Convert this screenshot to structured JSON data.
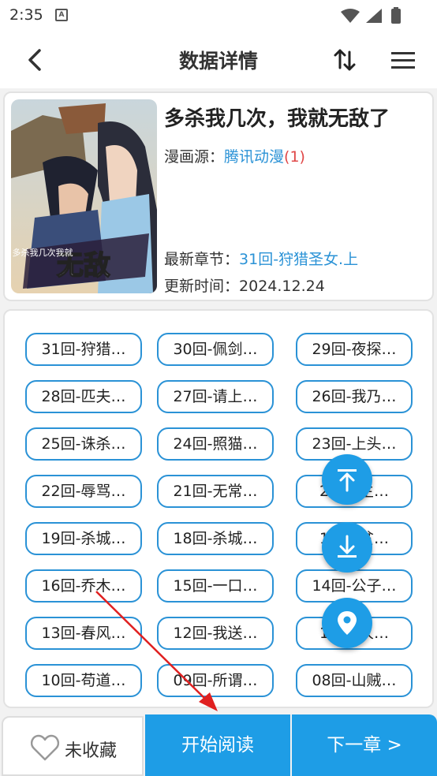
{
  "status": {
    "time": "2:35"
  },
  "appbar": {
    "title": "数据详情"
  },
  "comic": {
    "title": "多杀我几次，我就无敌了",
    "source_label": "漫画源：",
    "source_name": "腾讯动漫",
    "source_count": "(1)",
    "latest_label": "最新章节：",
    "latest_value": "31回-狩猎圣女.上",
    "update_label": "更新时间：",
    "update_value": "2024.12.24",
    "cover_title": "无敌",
    "cover_subtitle": "多杀我几次我就"
  },
  "chapters": [
    "31回-狩猎…",
    "30回-佩剑…",
    "29回-夜探…",
    "28回-匹夫…",
    "27回-请上…",
    "26回-我乃…",
    "25回-诛杀…",
    "24回-照猫…",
    "23回-上头…",
    "22回-辱骂…",
    "21回-无常…",
    "20回-主…",
    "19回-杀城…",
    "18回-杀城…",
    "17回-贫…",
    "16回-乔木…",
    "15回-一口…",
    "14回-公子…",
    "13回-春风…",
    "12回-我送…",
    "11回-人…",
    "10回-苟道…",
    "09回-所谓…",
    "08回-山贼…"
  ],
  "bottom": {
    "favorite_label": "未收藏",
    "read_label": "开始阅读",
    "next_label": "下一章 >"
  },
  "colors": {
    "accent": "#1e9de6",
    "link": "#2a92d6",
    "count": "#e04848"
  }
}
